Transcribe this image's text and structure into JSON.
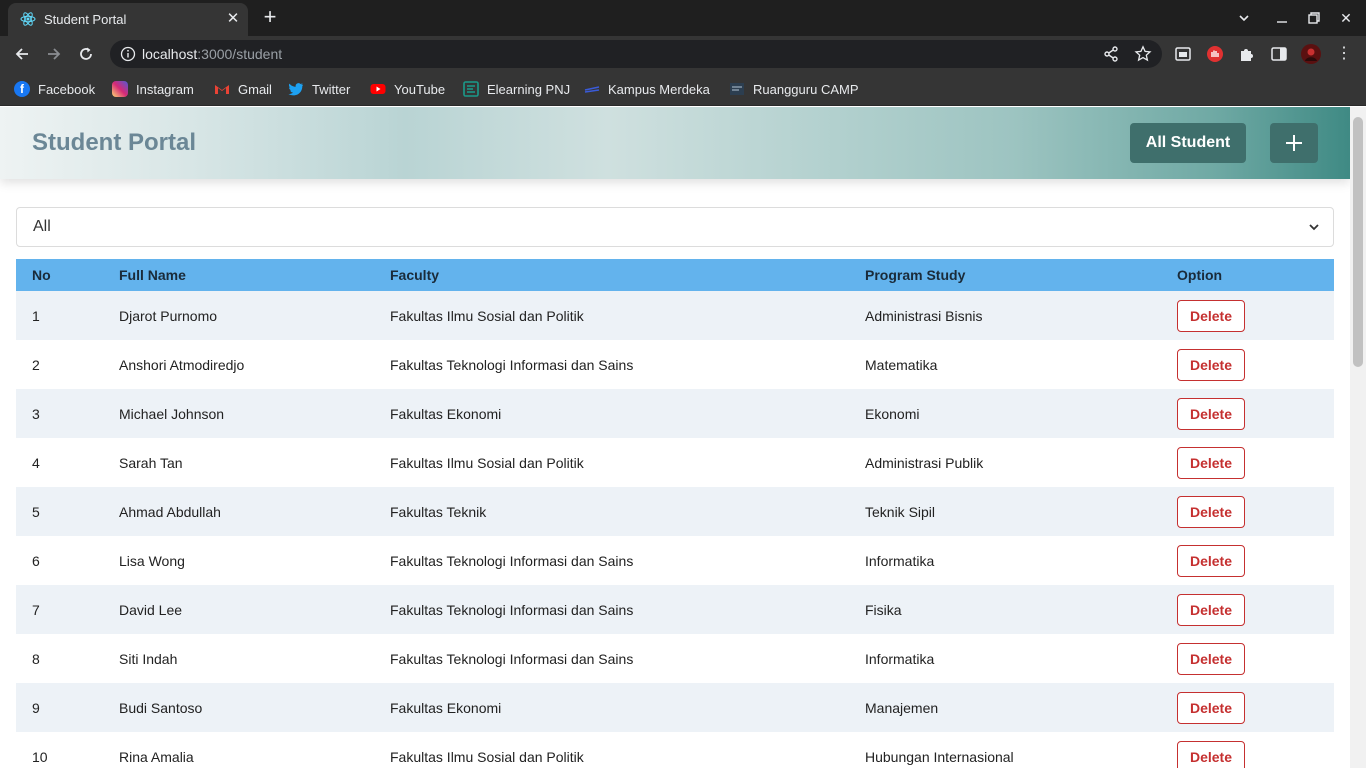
{
  "browser": {
    "tab_title": "Student Portal",
    "url_host": "localhost",
    "url_path": ":3000/student",
    "bookmarks": [
      {
        "label": "Facebook",
        "icon": "facebook-icon",
        "color": "#1877f2"
      },
      {
        "label": "Instagram",
        "icon": "instagram-icon",
        "color": "#d62976"
      },
      {
        "label": "Gmail",
        "icon": "gmail-icon",
        "color": "#ea4335"
      },
      {
        "label": "Twitter",
        "icon": "twitter-icon",
        "color": "#1da1f2"
      },
      {
        "label": "YouTube",
        "icon": "youtube-icon",
        "color": "#ff0000"
      },
      {
        "label": "Elearning PNJ",
        "icon": "elearning-icon",
        "color": "#1a9c8c"
      },
      {
        "label": "Kampus Merdeka",
        "icon": "kampus-merdeka-icon",
        "color": "#3a5bd9"
      },
      {
        "label": "Ruangguru CAMP",
        "icon": "ruangguru-icon",
        "color": "#6e7a82"
      }
    ]
  },
  "header": {
    "brand": "Student Portal",
    "all_student_label": "All Student",
    "add_icon": "plus-icon"
  },
  "filter": {
    "selected": "All"
  },
  "table": {
    "columns": [
      "No",
      "Full Name",
      "Faculty",
      "Program Study",
      "Option"
    ],
    "delete_label": "Delete",
    "rows": [
      {
        "no": "1",
        "name": "Djarot Purnomo",
        "faculty": "Fakultas Ilmu Sosial dan Politik",
        "program": "Administrasi Bisnis"
      },
      {
        "no": "2",
        "name": "Anshori Atmodiredjo",
        "faculty": "Fakultas Teknologi Informasi dan Sains",
        "program": "Matematika"
      },
      {
        "no": "3",
        "name": "Michael Johnson",
        "faculty": "Fakultas Ekonomi",
        "program": "Ekonomi"
      },
      {
        "no": "4",
        "name": "Sarah Tan",
        "faculty": "Fakultas Ilmu Sosial dan Politik",
        "program": "Administrasi Publik"
      },
      {
        "no": "5",
        "name": "Ahmad Abdullah",
        "faculty": "Fakultas Teknik",
        "program": "Teknik Sipil"
      },
      {
        "no": "6",
        "name": "Lisa Wong",
        "faculty": "Fakultas Teknologi Informasi dan Sains",
        "program": "Informatika"
      },
      {
        "no": "7",
        "name": "David Lee",
        "faculty": "Fakultas Teknologi Informasi dan Sains",
        "program": "Fisika"
      },
      {
        "no": "8",
        "name": "Siti Indah",
        "faculty": "Fakultas Teknologi Informasi dan Sains",
        "program": "Informatika"
      },
      {
        "no": "9",
        "name": "Budi Santoso",
        "faculty": "Fakultas Ekonomi",
        "program": "Manajemen"
      },
      {
        "no": "10",
        "name": "Rina Amalia",
        "faculty": "Fakultas Ilmu Sosial dan Politik",
        "program": "Hubungan Internasional"
      }
    ]
  }
}
